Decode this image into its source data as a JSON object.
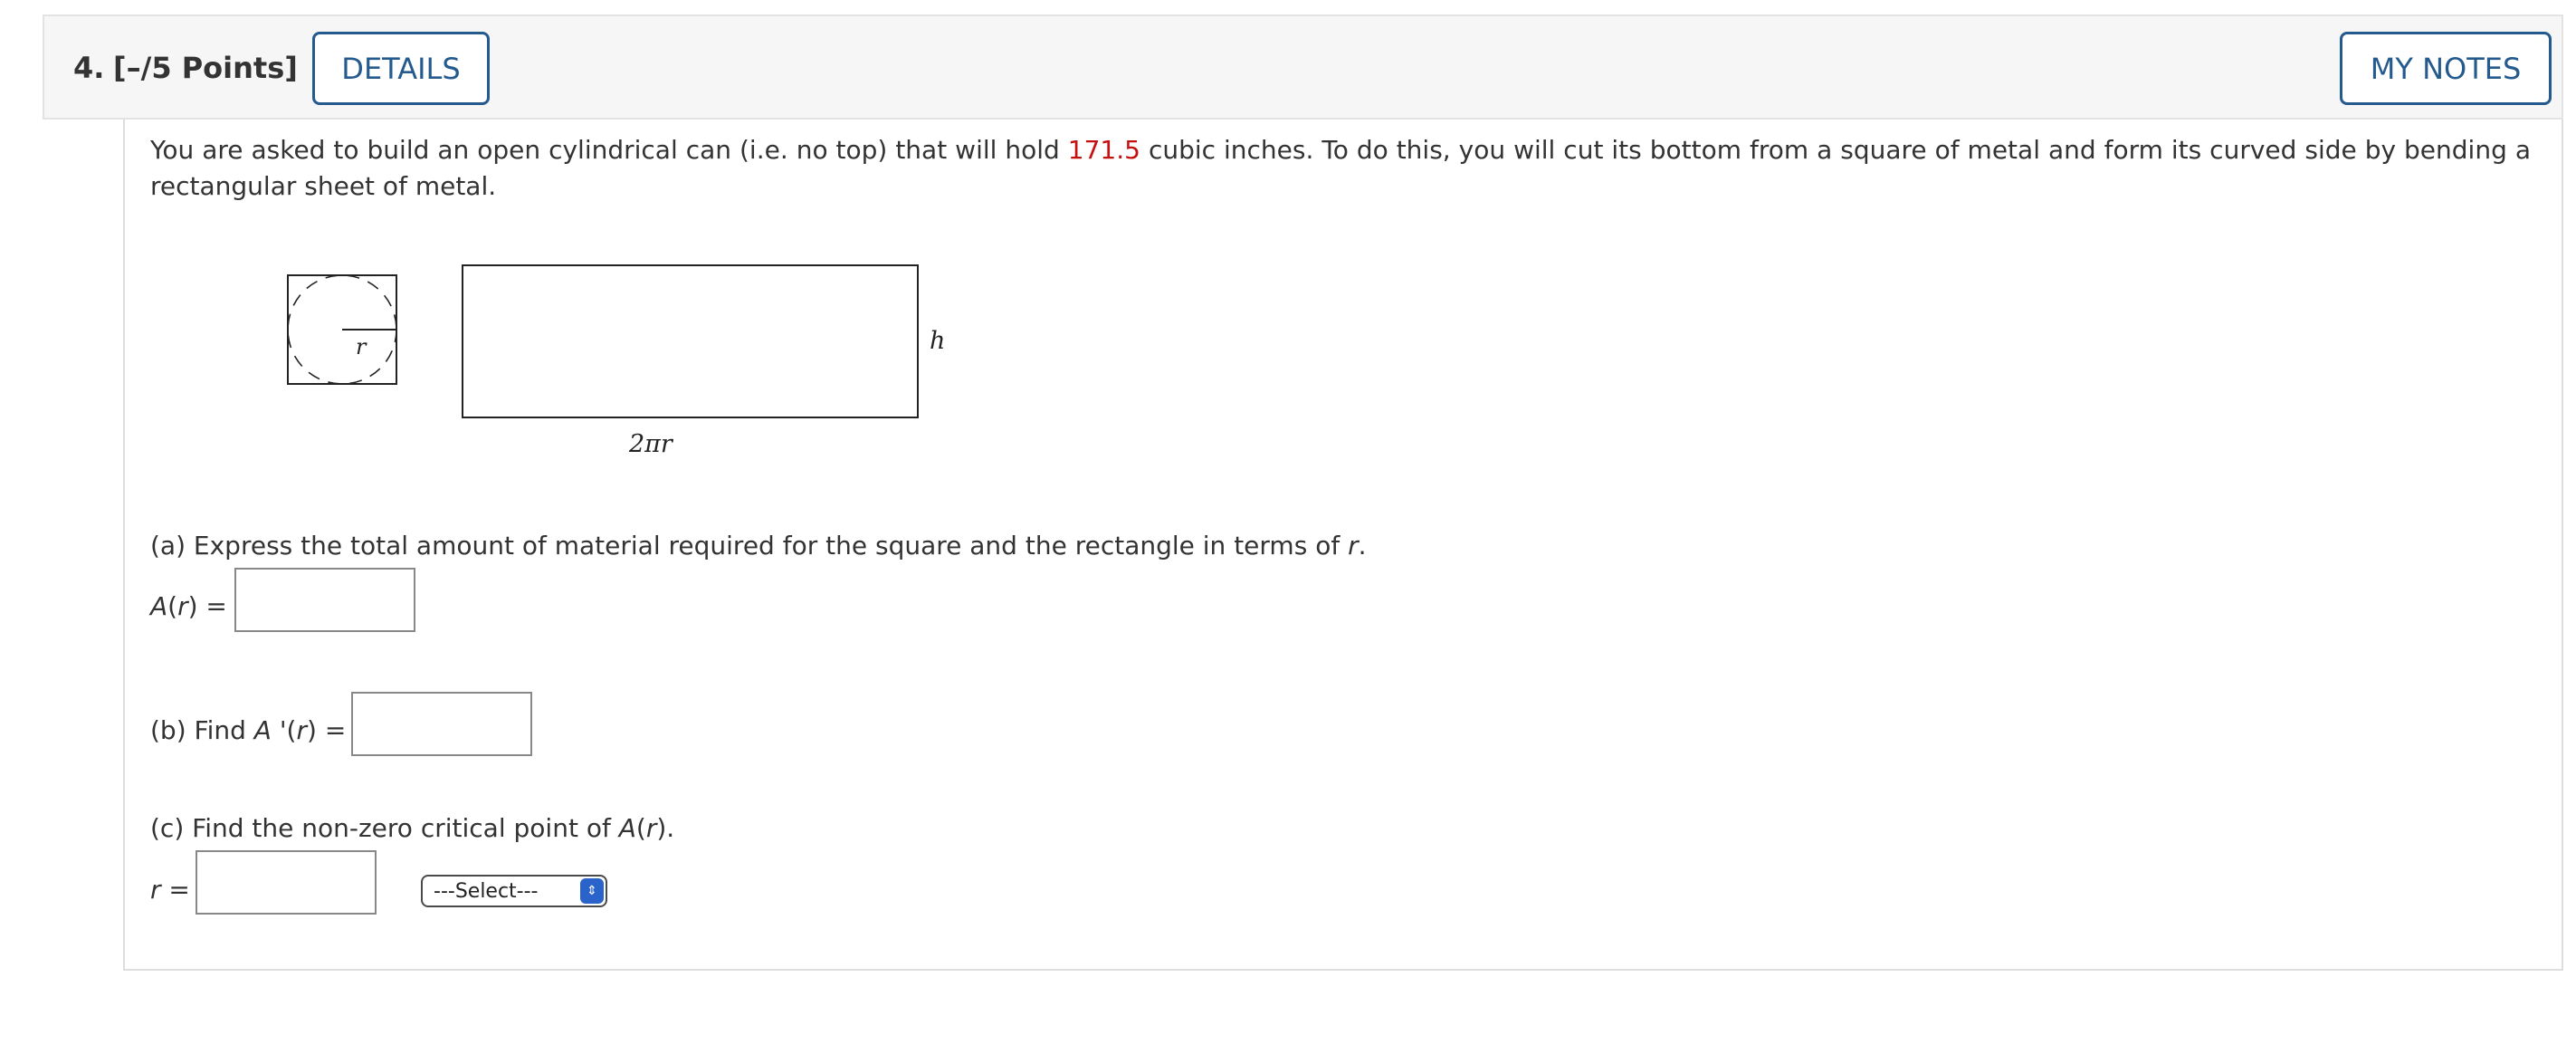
{
  "header": {
    "number": "4.",
    "points": "[–/5 Points]",
    "details_label": "DETAILS",
    "notes_label": "MY NOTES"
  },
  "intro": {
    "text_before": "You are asked to build an open cylindrical can (i.e. no top) that will hold ",
    "volume": "171.5",
    "text_after": " cubic inches. To do this, you will cut its bottom from a square of metal and form its curved side by bending a rectangular sheet of metal."
  },
  "figure": {
    "radius_label": "r",
    "height_label": "h",
    "width_label": "2πr"
  },
  "part_a": {
    "prompt_before": "(a) Express the total amount of material required for the square and the rectangle in terms of ",
    "prompt_var": "r",
    "prompt_after": ".",
    "lhs_func": "A",
    "lhs_open": "(",
    "lhs_var": "r",
    "lhs_close": ") =",
    "answer": ""
  },
  "part_b": {
    "prompt_before": "(b) Find ",
    "func": "A",
    "prime_open": " '(",
    "var": "r",
    "close": ") =",
    "answer": ""
  },
  "part_c": {
    "prompt_before": "(c) Find the non-zero critical point of ",
    "func": "A",
    "open": "(",
    "var": "r",
    "close": ").",
    "lhs_var": "r",
    "lhs_eq": " =",
    "answer": "",
    "select_value": "---Select---"
  },
  "colors": {
    "accent": "#245a8d",
    "highlight": "#c51010",
    "select_arrow": "#2a63c9"
  }
}
